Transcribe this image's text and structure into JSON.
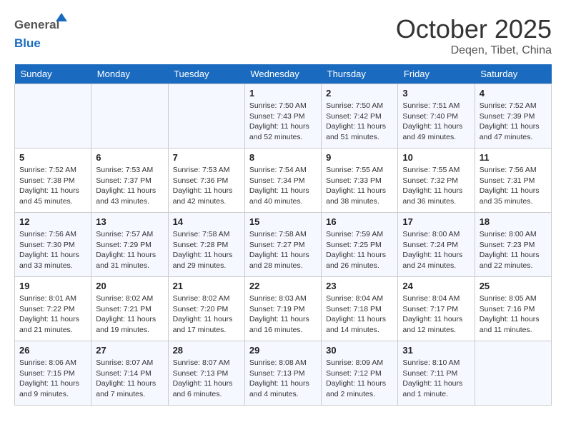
{
  "header": {
    "logo_general": "General",
    "logo_blue": "Blue",
    "month": "October 2025",
    "location": "Deqen, Tibet, China"
  },
  "days_of_week": [
    "Sunday",
    "Monday",
    "Tuesday",
    "Wednesday",
    "Thursday",
    "Friday",
    "Saturday"
  ],
  "weeks": [
    [
      {
        "day": "",
        "info": ""
      },
      {
        "day": "",
        "info": ""
      },
      {
        "day": "",
        "info": ""
      },
      {
        "day": "1",
        "info": "Sunrise: 7:50 AM\nSunset: 7:43 PM\nDaylight: 11 hours\nand 52 minutes."
      },
      {
        "day": "2",
        "info": "Sunrise: 7:50 AM\nSunset: 7:42 PM\nDaylight: 11 hours\nand 51 minutes."
      },
      {
        "day": "3",
        "info": "Sunrise: 7:51 AM\nSunset: 7:40 PM\nDaylight: 11 hours\nand 49 minutes."
      },
      {
        "day": "4",
        "info": "Sunrise: 7:52 AM\nSunset: 7:39 PM\nDaylight: 11 hours\nand 47 minutes."
      }
    ],
    [
      {
        "day": "5",
        "info": "Sunrise: 7:52 AM\nSunset: 7:38 PM\nDaylight: 11 hours\nand 45 minutes."
      },
      {
        "day": "6",
        "info": "Sunrise: 7:53 AM\nSunset: 7:37 PM\nDaylight: 11 hours\nand 43 minutes."
      },
      {
        "day": "7",
        "info": "Sunrise: 7:53 AM\nSunset: 7:36 PM\nDaylight: 11 hours\nand 42 minutes."
      },
      {
        "day": "8",
        "info": "Sunrise: 7:54 AM\nSunset: 7:34 PM\nDaylight: 11 hours\nand 40 minutes."
      },
      {
        "day": "9",
        "info": "Sunrise: 7:55 AM\nSunset: 7:33 PM\nDaylight: 11 hours\nand 38 minutes."
      },
      {
        "day": "10",
        "info": "Sunrise: 7:55 AM\nSunset: 7:32 PM\nDaylight: 11 hours\nand 36 minutes."
      },
      {
        "day": "11",
        "info": "Sunrise: 7:56 AM\nSunset: 7:31 PM\nDaylight: 11 hours\nand 35 minutes."
      }
    ],
    [
      {
        "day": "12",
        "info": "Sunrise: 7:56 AM\nSunset: 7:30 PM\nDaylight: 11 hours\nand 33 minutes."
      },
      {
        "day": "13",
        "info": "Sunrise: 7:57 AM\nSunset: 7:29 PM\nDaylight: 11 hours\nand 31 minutes."
      },
      {
        "day": "14",
        "info": "Sunrise: 7:58 AM\nSunset: 7:28 PM\nDaylight: 11 hours\nand 29 minutes."
      },
      {
        "day": "15",
        "info": "Sunrise: 7:58 AM\nSunset: 7:27 PM\nDaylight: 11 hours\nand 28 minutes."
      },
      {
        "day": "16",
        "info": "Sunrise: 7:59 AM\nSunset: 7:25 PM\nDaylight: 11 hours\nand 26 minutes."
      },
      {
        "day": "17",
        "info": "Sunrise: 8:00 AM\nSunset: 7:24 PM\nDaylight: 11 hours\nand 24 minutes."
      },
      {
        "day": "18",
        "info": "Sunrise: 8:00 AM\nSunset: 7:23 PM\nDaylight: 11 hours\nand 22 minutes."
      }
    ],
    [
      {
        "day": "19",
        "info": "Sunrise: 8:01 AM\nSunset: 7:22 PM\nDaylight: 11 hours\nand 21 minutes."
      },
      {
        "day": "20",
        "info": "Sunrise: 8:02 AM\nSunset: 7:21 PM\nDaylight: 11 hours\nand 19 minutes."
      },
      {
        "day": "21",
        "info": "Sunrise: 8:02 AM\nSunset: 7:20 PM\nDaylight: 11 hours\nand 17 minutes."
      },
      {
        "day": "22",
        "info": "Sunrise: 8:03 AM\nSunset: 7:19 PM\nDaylight: 11 hours\nand 16 minutes."
      },
      {
        "day": "23",
        "info": "Sunrise: 8:04 AM\nSunset: 7:18 PM\nDaylight: 11 hours\nand 14 minutes."
      },
      {
        "day": "24",
        "info": "Sunrise: 8:04 AM\nSunset: 7:17 PM\nDaylight: 11 hours\nand 12 minutes."
      },
      {
        "day": "25",
        "info": "Sunrise: 8:05 AM\nSunset: 7:16 PM\nDaylight: 11 hours\nand 11 minutes."
      }
    ],
    [
      {
        "day": "26",
        "info": "Sunrise: 8:06 AM\nSunset: 7:15 PM\nDaylight: 11 hours\nand 9 minutes."
      },
      {
        "day": "27",
        "info": "Sunrise: 8:07 AM\nSunset: 7:14 PM\nDaylight: 11 hours\nand 7 minutes."
      },
      {
        "day": "28",
        "info": "Sunrise: 8:07 AM\nSunset: 7:13 PM\nDaylight: 11 hours\nand 6 minutes."
      },
      {
        "day": "29",
        "info": "Sunrise: 8:08 AM\nSunset: 7:13 PM\nDaylight: 11 hours\nand 4 minutes."
      },
      {
        "day": "30",
        "info": "Sunrise: 8:09 AM\nSunset: 7:12 PM\nDaylight: 11 hours\nand 2 minutes."
      },
      {
        "day": "31",
        "info": "Sunrise: 8:10 AM\nSunset: 7:11 PM\nDaylight: 11 hours\nand 1 minute."
      },
      {
        "day": "",
        "info": ""
      }
    ]
  ]
}
